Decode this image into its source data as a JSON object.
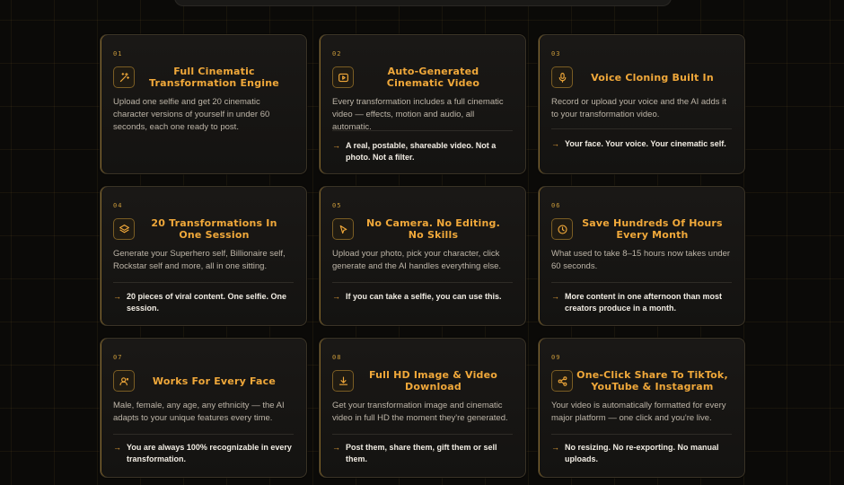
{
  "cards": [
    {
      "num": "01",
      "icon": "sparkle-wand-icon",
      "title": "Full Cinematic Transformation Engine",
      "desc": "Upload one selfie and get 20 cinematic character versions of yourself in under 60 seconds, each one ready to post.",
      "bullet": ""
    },
    {
      "num": "02",
      "icon": "video-play-icon",
      "title": "Auto-Generated Cinematic Video",
      "desc": "Every transformation includes a full cinematic video — effects, motion and audio, all automatic.",
      "bullet": "A real, postable, shareable video. Not a photo. Not a filter."
    },
    {
      "num": "03",
      "icon": "microphone-icon",
      "title": "Voice Cloning Built In",
      "desc": "Record or upload your voice and the AI adds it to your transformation video.",
      "bullet": "Your face. Your voice. Your cinematic self."
    },
    {
      "num": "04",
      "icon": "layers-icon",
      "title": "20 Transformations In One Session",
      "desc": "Generate your Superhero self, Billionaire self, Rockstar self and more, all in one sitting.",
      "bullet": "20 pieces of viral content. One selfie. One session."
    },
    {
      "num": "05",
      "icon": "cursor-pointer-icon",
      "title": "No Camera. No Editing. No Skills",
      "desc": "Upload your photo, pick your character, click generate and the AI handles everything else.",
      "bullet": "If you can take a selfie, you can use this."
    },
    {
      "num": "06",
      "icon": "clock-icon",
      "title": "Save Hundreds Of Hours Every Month",
      "desc": "What used to take 8–15 hours now takes under 60 seconds.",
      "bullet": "More content in one afternoon than most creators produce in a month."
    },
    {
      "num": "07",
      "icon": "user-face-icon",
      "title": "Works For Every Face",
      "desc": "Male, female, any age, any ethnicity — the AI adapts to your unique features every time.",
      "bullet": "You are always 100% recognizable in every transformation."
    },
    {
      "num": "08",
      "icon": "download-icon",
      "title": "Full HD Image & Video Download",
      "desc": "Get your transformation image and cinematic video in full HD the moment they're generated.",
      "bullet": "Post them, share them, gift them or sell them."
    },
    {
      "num": "09",
      "icon": "share-icon",
      "title": "One-Click Share To TikTok, YouTube & Instagram",
      "desc": "Your video is automatically formatted for every major platform — one click and you're live.",
      "bullet": "No resizing. No re-exporting. No manual uploads."
    }
  ],
  "colors": {
    "accent": "#f0a83a",
    "bg": "#0b0a08",
    "card": "#161412"
  }
}
